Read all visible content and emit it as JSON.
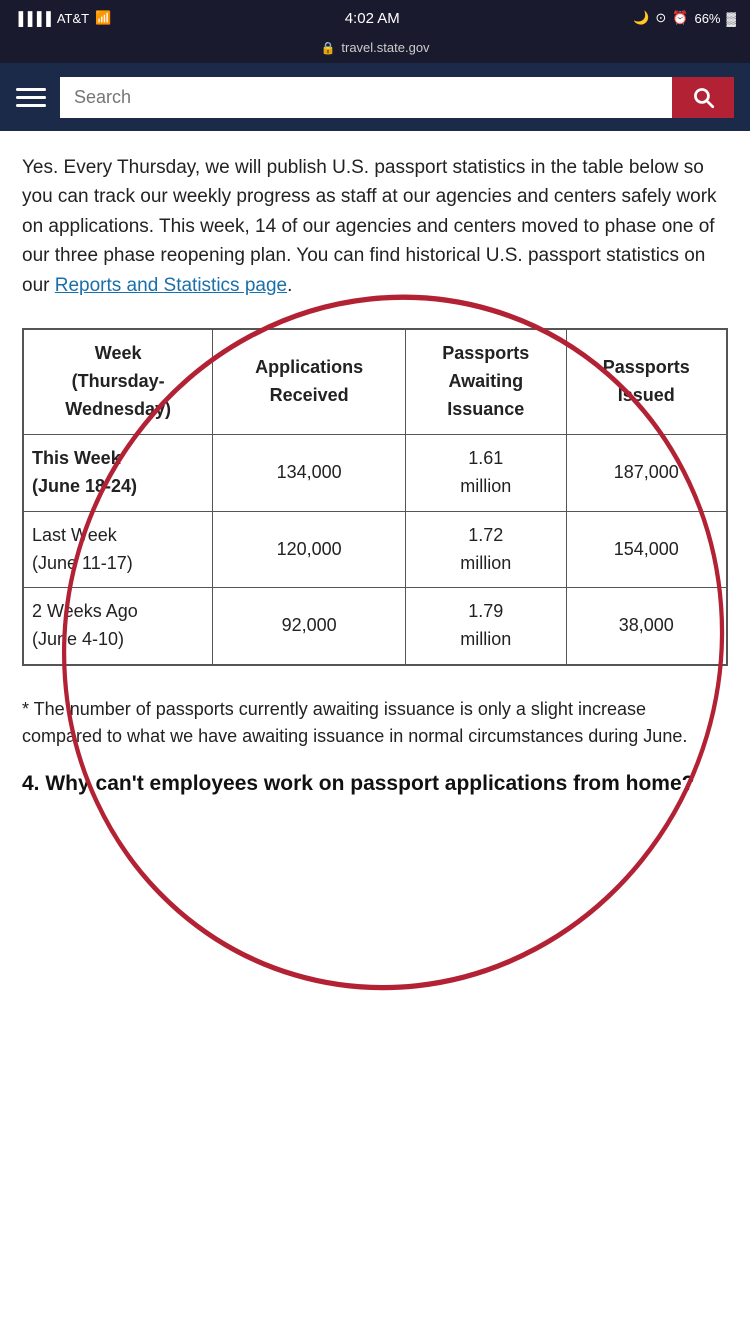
{
  "statusBar": {
    "carrier": "AT&T",
    "time": "4:02 AM",
    "battery": "66%"
  },
  "addressBar": {
    "url": "travel.state.gov"
  },
  "nav": {
    "searchPlaceholder": "Search"
  },
  "content": {
    "paragraph": "Yes. Every Thursday, we will publish U.S. passport statistics in the table below so you can track our weekly progress as staff at our agencies and centers safely work on applications. This week, 14 of our agencies and centers moved to phase one of our three phase reopening plan. You can find historical U.S. passport statistics on our",
    "linkText": "Reports and Statistics page",
    "periodAfterLink": "."
  },
  "table": {
    "headers": [
      "Week (Thursday-Wednesday)",
      "Applications Received",
      "Passports Awaiting Issuance",
      "Passports Issued"
    ],
    "rows": [
      {
        "week": "This Week",
        "weekSub": "(June 18-24)",
        "applications": "134,000",
        "awaiting": "1.61 million",
        "issued": "187,000",
        "bold": true
      },
      {
        "week": "Last Week",
        "weekSub": "(June 11-17)",
        "applications": "120,000",
        "awaiting": "1.72 million",
        "issued": "154,000",
        "bold": false
      },
      {
        "week": "2 Weeks Ago",
        "weekSub": "(June 4-10)",
        "applications": "92,000",
        "awaiting": "1.79 million",
        "issued": "38,000",
        "bold": false
      }
    ]
  },
  "footnote": "* The number of passports currently awaiting issuance is only a slight increase compared to what we have awaiting issuance in normal circumstances during June.",
  "sectionHeading": "4. Why can't employees work on passport applications from home?"
}
